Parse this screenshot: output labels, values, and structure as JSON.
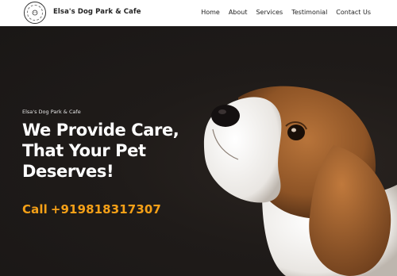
{
  "header": {
    "brand": "Elsa's Dog Park & Cafe",
    "nav": [
      "Home",
      "About",
      "Services",
      "Testimonial",
      "Contact Us"
    ]
  },
  "hero": {
    "eyebrow": "Elsa's Dog Park & Cafe",
    "headline": [
      "We Provide Care,",
      "That Your Pet",
      "Deserves!"
    ],
    "phone_label": "Call",
    "phone_number": "+919818317307"
  },
  "colors": {
    "accent": "#f5a017",
    "hero_bg": "#1f1b19",
    "text_light": "#ffffff"
  }
}
